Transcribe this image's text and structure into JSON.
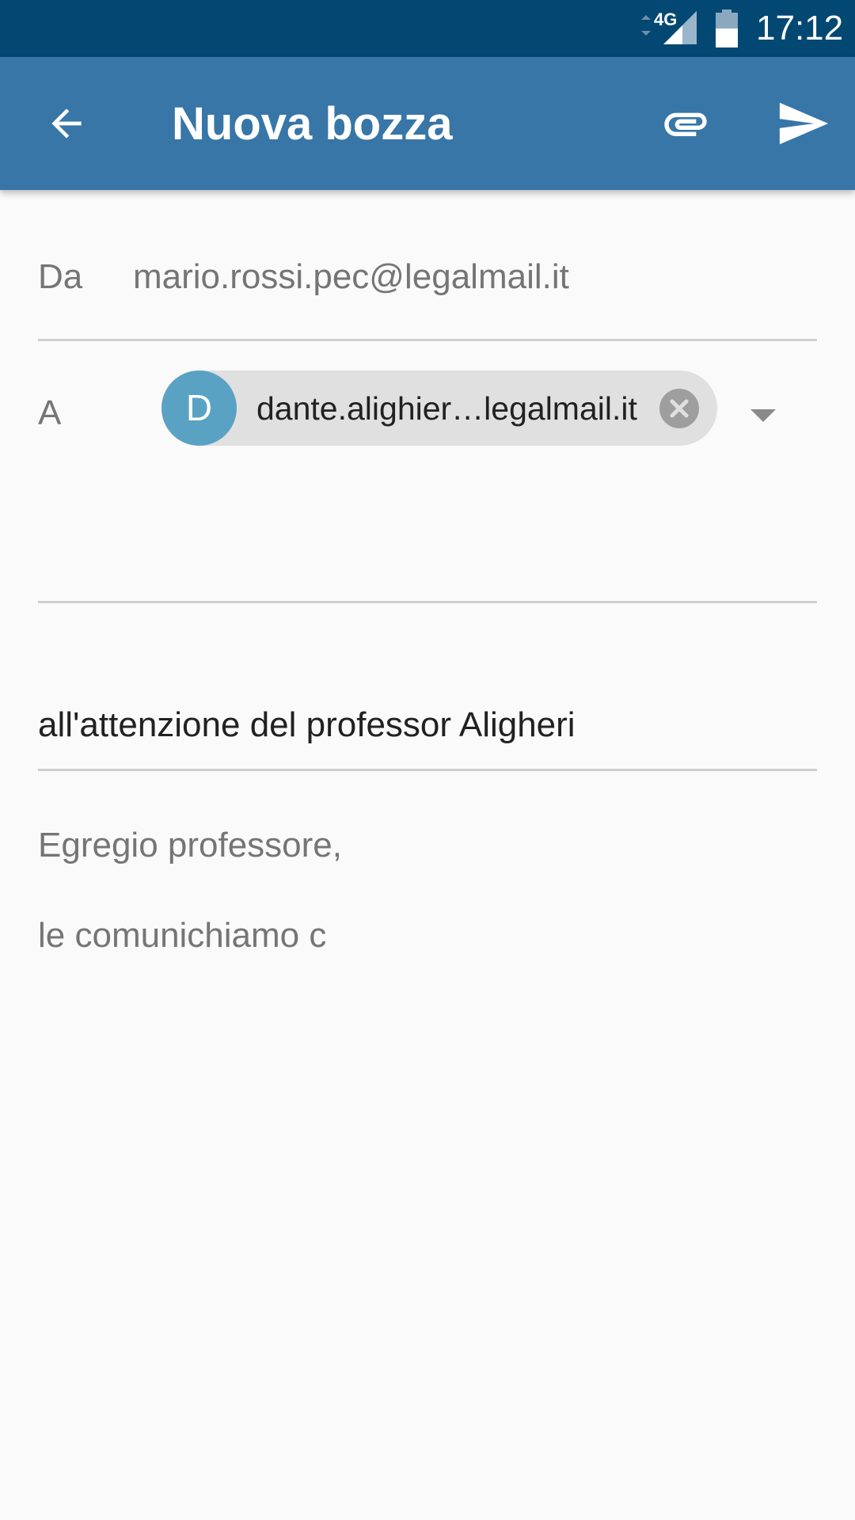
{
  "status_bar": {
    "network": "4G",
    "time": "17:12"
  },
  "app_bar": {
    "title": "Nuova bozza",
    "icons": {
      "back": "arrow-back-icon",
      "attach": "paperclip-icon",
      "send": "send-icon"
    }
  },
  "compose": {
    "from_label": "Da",
    "from_value": "mario.rossi.pec@legalmail.it",
    "to_label": "A",
    "recipient": {
      "avatar_letter": "D",
      "display": "dante.alighier…legalmail.it"
    },
    "subject": "all'attenzione del professor Aligheri",
    "body": {
      "line1": "Egregio professore,",
      "line2": "le comunichiamo c"
    }
  },
  "colors": {
    "status_bar": "#034872",
    "app_bar": "#3776a7",
    "avatar": "#5aa2c3",
    "chip": "#e0e0e0"
  }
}
